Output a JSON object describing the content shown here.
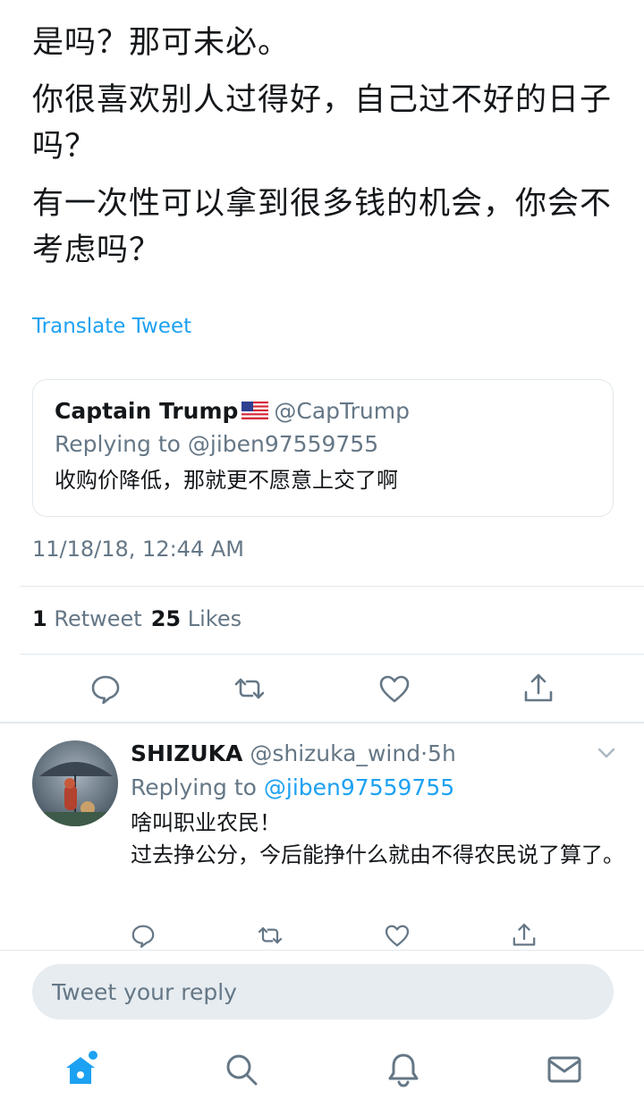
{
  "tweet": {
    "paragraphs": [
      "是吗？那可未必。",
      "你很喜欢别人过得好，自己过不好的日子吗？",
      "有一次性可以拿到很多钱的机会，你会不考虑吗？"
    ],
    "translate_label": "Translate Tweet",
    "timestamp": "11/18/18, 12:44 AM",
    "retweet_count": "1",
    "retweet_label": "Retweet",
    "like_count": "25",
    "like_label": "Likes"
  },
  "quoted_tweet": {
    "name": "Captain Trump",
    "flag_icon": "us-flag-icon",
    "handle": "@CapTrump",
    "replying_to": "Replying to @jiben97559755",
    "text": "收购价降低，那就更不愿意上交了啊"
  },
  "reply": {
    "name": "SHIZUKA",
    "handle": "@shizuka_wind",
    "separator": "·",
    "time": "5h",
    "replying_prefix": "Replying to",
    "replying_mention": "@jiben97559755",
    "lines": [
      "啥叫职业农民！",
      "过去挣公分，今后能挣什么就由不得农民说了算了。"
    ]
  },
  "action_icons": [
    "reply-icon",
    "retweet-icon",
    "like-icon",
    "share-icon"
  ],
  "compose": {
    "placeholder": "Tweet your reply"
  },
  "tabbar": {
    "icons": [
      "home-icon",
      "search-icon",
      "notifications-icon",
      "messages-icon"
    ]
  },
  "colors": {
    "accent": "#1da1f2",
    "text": "#14171a",
    "secondary": "#657786",
    "border": "#e1e8ed",
    "input_bg": "#e6ecf0"
  }
}
